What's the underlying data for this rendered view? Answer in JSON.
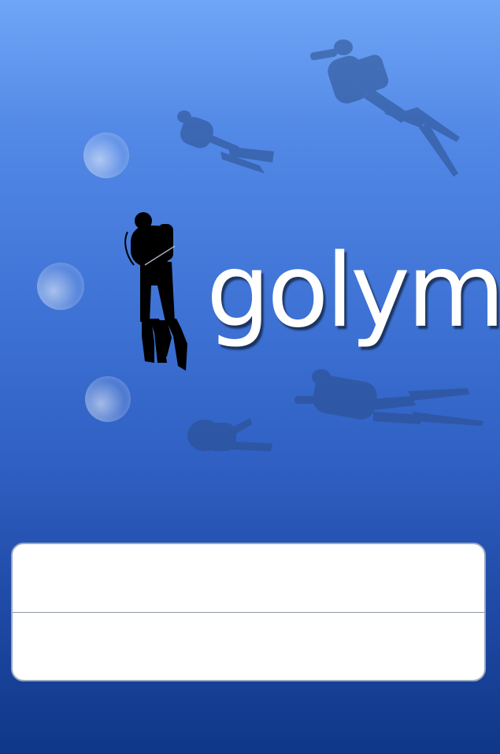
{
  "app": {
    "name": "golym",
    "background": {
      "top": "#6fa6f6",
      "bottom": "#0f3788"
    }
  },
  "login_form": {
    "first_field": {
      "value": "",
      "placeholder": ""
    },
    "second_field": {
      "value": "",
      "placeholder": ""
    }
  }
}
